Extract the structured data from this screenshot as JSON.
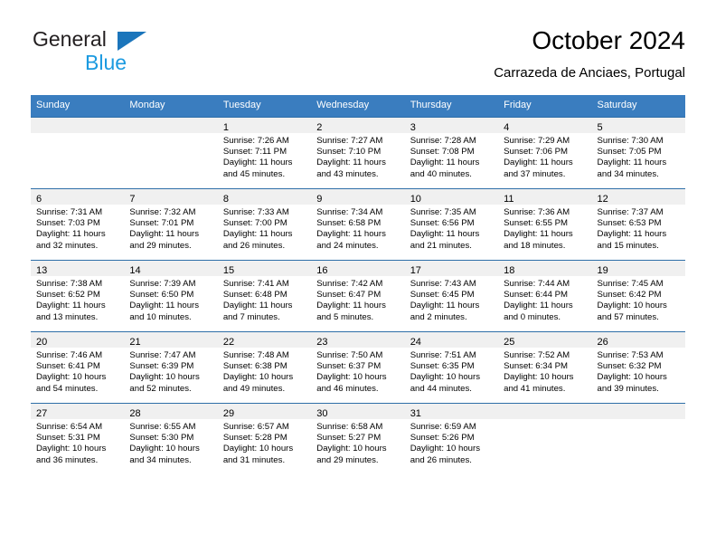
{
  "brand": {
    "word1": "General",
    "word2": "Blue",
    "triangle_color": "#1b75bb",
    "blue_color": "#1b9ae0"
  },
  "header": {
    "title": "October 2024",
    "subtitle": "Carrazeda de Anciaes, Portugal"
  },
  "theme": {
    "header_row_bg": "#3a7dbf",
    "row_divider": "#2f6fa8",
    "daynum_band_bg": "#f0f0f0"
  },
  "weekdays": [
    "Sunday",
    "Monday",
    "Tuesday",
    "Wednesday",
    "Thursday",
    "Friday",
    "Saturday"
  ],
  "weeks": [
    [
      {
        "day": "",
        "l1": "",
        "l2": "",
        "l3": "",
        "l4": ""
      },
      {
        "day": "",
        "l1": "",
        "l2": "",
        "l3": "",
        "l4": ""
      },
      {
        "day": "1",
        "l1": "Sunrise: 7:26 AM",
        "l2": "Sunset: 7:11 PM",
        "l3": "Daylight: 11 hours",
        "l4": "and 45 minutes."
      },
      {
        "day": "2",
        "l1": "Sunrise: 7:27 AM",
        "l2": "Sunset: 7:10 PM",
        "l3": "Daylight: 11 hours",
        "l4": "and 43 minutes."
      },
      {
        "day": "3",
        "l1": "Sunrise: 7:28 AM",
        "l2": "Sunset: 7:08 PM",
        "l3": "Daylight: 11 hours",
        "l4": "and 40 minutes."
      },
      {
        "day": "4",
        "l1": "Sunrise: 7:29 AM",
        "l2": "Sunset: 7:06 PM",
        "l3": "Daylight: 11 hours",
        "l4": "and 37 minutes."
      },
      {
        "day": "5",
        "l1": "Sunrise: 7:30 AM",
        "l2": "Sunset: 7:05 PM",
        "l3": "Daylight: 11 hours",
        "l4": "and 34 minutes."
      }
    ],
    [
      {
        "day": "6",
        "l1": "Sunrise: 7:31 AM",
        "l2": "Sunset: 7:03 PM",
        "l3": "Daylight: 11 hours",
        "l4": "and 32 minutes."
      },
      {
        "day": "7",
        "l1": "Sunrise: 7:32 AM",
        "l2": "Sunset: 7:01 PM",
        "l3": "Daylight: 11 hours",
        "l4": "and 29 minutes."
      },
      {
        "day": "8",
        "l1": "Sunrise: 7:33 AM",
        "l2": "Sunset: 7:00 PM",
        "l3": "Daylight: 11 hours",
        "l4": "and 26 minutes."
      },
      {
        "day": "9",
        "l1": "Sunrise: 7:34 AM",
        "l2": "Sunset: 6:58 PM",
        "l3": "Daylight: 11 hours",
        "l4": "and 24 minutes."
      },
      {
        "day": "10",
        "l1": "Sunrise: 7:35 AM",
        "l2": "Sunset: 6:56 PM",
        "l3": "Daylight: 11 hours",
        "l4": "and 21 minutes."
      },
      {
        "day": "11",
        "l1": "Sunrise: 7:36 AM",
        "l2": "Sunset: 6:55 PM",
        "l3": "Daylight: 11 hours",
        "l4": "and 18 minutes."
      },
      {
        "day": "12",
        "l1": "Sunrise: 7:37 AM",
        "l2": "Sunset: 6:53 PM",
        "l3": "Daylight: 11 hours",
        "l4": "and 15 minutes."
      }
    ],
    [
      {
        "day": "13",
        "l1": "Sunrise: 7:38 AM",
        "l2": "Sunset: 6:52 PM",
        "l3": "Daylight: 11 hours",
        "l4": "and 13 minutes."
      },
      {
        "day": "14",
        "l1": "Sunrise: 7:39 AM",
        "l2": "Sunset: 6:50 PM",
        "l3": "Daylight: 11 hours",
        "l4": "and 10 minutes."
      },
      {
        "day": "15",
        "l1": "Sunrise: 7:41 AM",
        "l2": "Sunset: 6:48 PM",
        "l3": "Daylight: 11 hours",
        "l4": "and 7 minutes."
      },
      {
        "day": "16",
        "l1": "Sunrise: 7:42 AM",
        "l2": "Sunset: 6:47 PM",
        "l3": "Daylight: 11 hours",
        "l4": "and 5 minutes."
      },
      {
        "day": "17",
        "l1": "Sunrise: 7:43 AM",
        "l2": "Sunset: 6:45 PM",
        "l3": "Daylight: 11 hours",
        "l4": "and 2 minutes."
      },
      {
        "day": "18",
        "l1": "Sunrise: 7:44 AM",
        "l2": "Sunset: 6:44 PM",
        "l3": "Daylight: 11 hours",
        "l4": "and 0 minutes."
      },
      {
        "day": "19",
        "l1": "Sunrise: 7:45 AM",
        "l2": "Sunset: 6:42 PM",
        "l3": "Daylight: 10 hours",
        "l4": "and 57 minutes."
      }
    ],
    [
      {
        "day": "20",
        "l1": "Sunrise: 7:46 AM",
        "l2": "Sunset: 6:41 PM",
        "l3": "Daylight: 10 hours",
        "l4": "and 54 minutes."
      },
      {
        "day": "21",
        "l1": "Sunrise: 7:47 AM",
        "l2": "Sunset: 6:39 PM",
        "l3": "Daylight: 10 hours",
        "l4": "and 52 minutes."
      },
      {
        "day": "22",
        "l1": "Sunrise: 7:48 AM",
        "l2": "Sunset: 6:38 PM",
        "l3": "Daylight: 10 hours",
        "l4": "and 49 minutes."
      },
      {
        "day": "23",
        "l1": "Sunrise: 7:50 AM",
        "l2": "Sunset: 6:37 PM",
        "l3": "Daylight: 10 hours",
        "l4": "and 46 minutes."
      },
      {
        "day": "24",
        "l1": "Sunrise: 7:51 AM",
        "l2": "Sunset: 6:35 PM",
        "l3": "Daylight: 10 hours",
        "l4": "and 44 minutes."
      },
      {
        "day": "25",
        "l1": "Sunrise: 7:52 AM",
        "l2": "Sunset: 6:34 PM",
        "l3": "Daylight: 10 hours",
        "l4": "and 41 minutes."
      },
      {
        "day": "26",
        "l1": "Sunrise: 7:53 AM",
        "l2": "Sunset: 6:32 PM",
        "l3": "Daylight: 10 hours",
        "l4": "and 39 minutes."
      }
    ],
    [
      {
        "day": "27",
        "l1": "Sunrise: 6:54 AM",
        "l2": "Sunset: 5:31 PM",
        "l3": "Daylight: 10 hours",
        "l4": "and 36 minutes."
      },
      {
        "day": "28",
        "l1": "Sunrise: 6:55 AM",
        "l2": "Sunset: 5:30 PM",
        "l3": "Daylight: 10 hours",
        "l4": "and 34 minutes."
      },
      {
        "day": "29",
        "l1": "Sunrise: 6:57 AM",
        "l2": "Sunset: 5:28 PM",
        "l3": "Daylight: 10 hours",
        "l4": "and 31 minutes."
      },
      {
        "day": "30",
        "l1": "Sunrise: 6:58 AM",
        "l2": "Sunset: 5:27 PM",
        "l3": "Daylight: 10 hours",
        "l4": "and 29 minutes."
      },
      {
        "day": "31",
        "l1": "Sunrise: 6:59 AM",
        "l2": "Sunset: 5:26 PM",
        "l3": "Daylight: 10 hours",
        "l4": "and 26 minutes."
      },
      {
        "day": "",
        "l1": "",
        "l2": "",
        "l3": "",
        "l4": ""
      },
      {
        "day": "",
        "l1": "",
        "l2": "",
        "l3": "",
        "l4": ""
      }
    ]
  ]
}
